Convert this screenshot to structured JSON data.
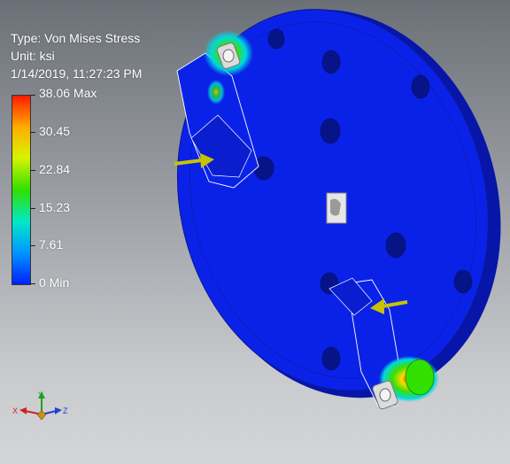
{
  "result": {
    "type_line": "Type: Von Mises Stress",
    "unit_line": "Unit: ksi",
    "timestamp_line": "1/14/2019, 11:27:23 PM"
  },
  "legend": {
    "max_label": "38.06 Max",
    "labels": [
      "30.45",
      "22.84",
      "15.23",
      "7.61"
    ],
    "min_label": "0 Min",
    "colors": [
      "#ff1a00",
      "#ffae00",
      "#d7f400",
      "#32e000",
      "#00e8c8",
      "#0098ff",
      "#0020ff"
    ]
  },
  "triad": {
    "x": "X",
    "y": "Y",
    "z": "Z"
  },
  "colors": {
    "plate": "#0a22e8",
    "plate_edge": "#0716a8",
    "arrow": "#c9c200"
  }
}
